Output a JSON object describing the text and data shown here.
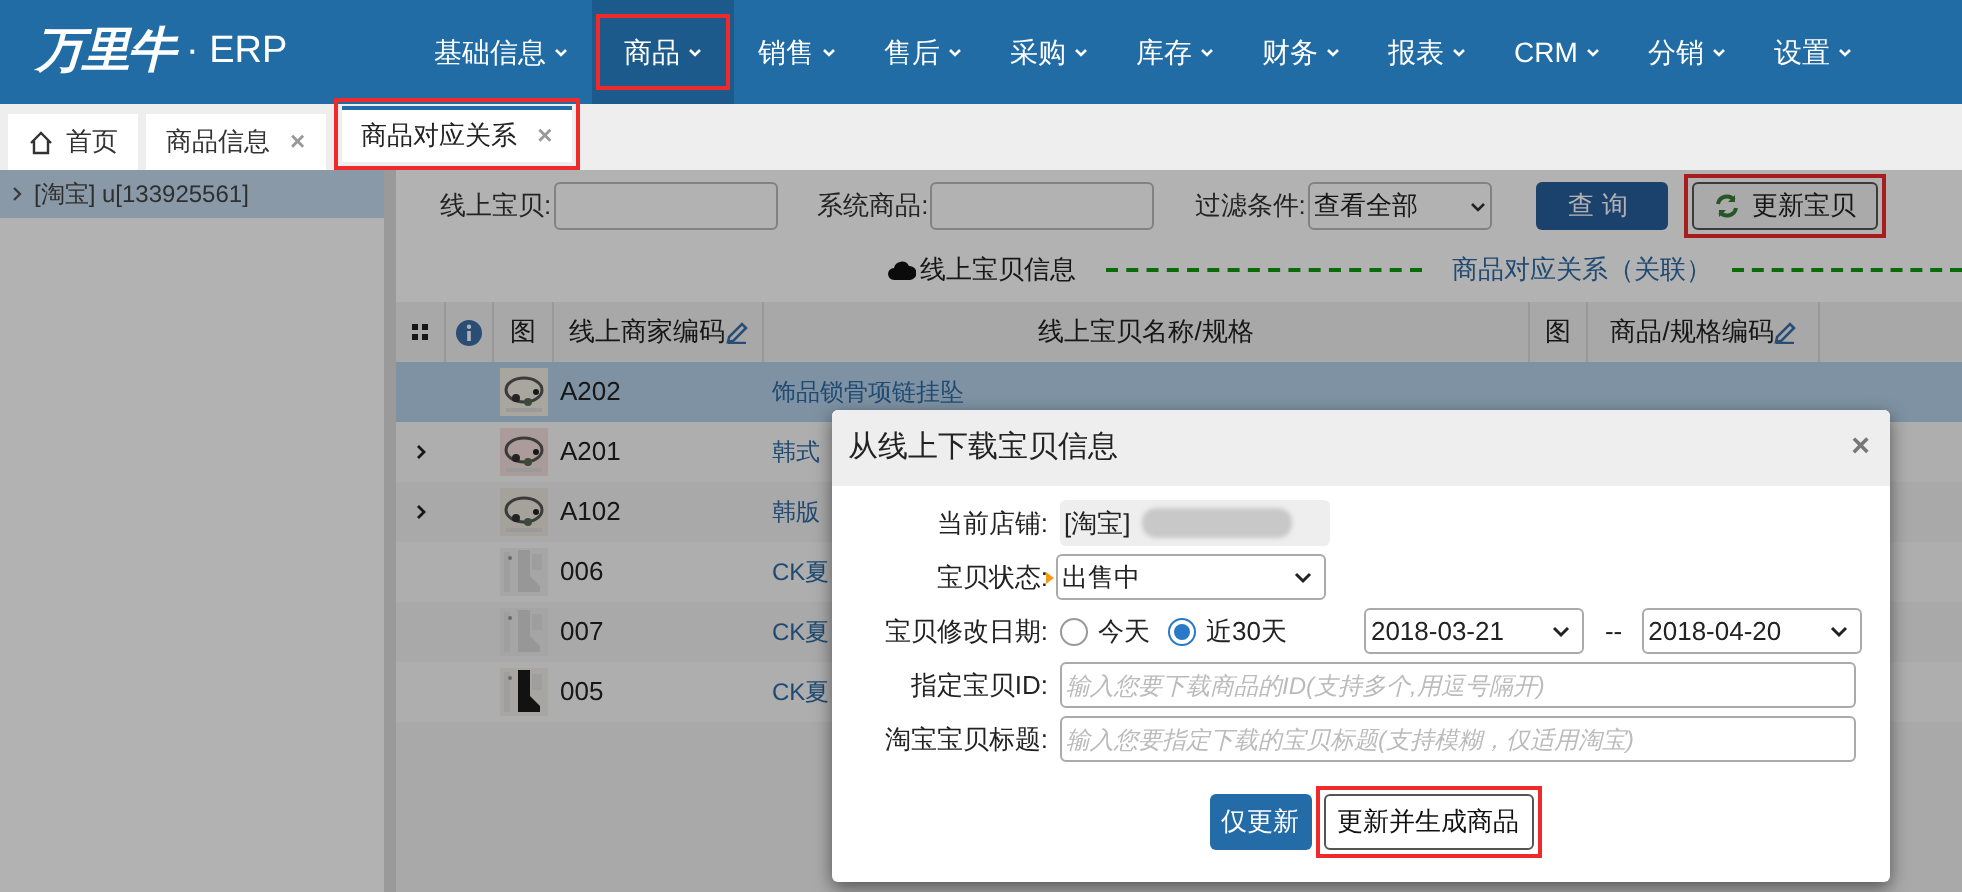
{
  "header": {
    "logo": "万里牛",
    "logo_suffix": "· ERP",
    "nav": [
      {
        "label": "基础信息",
        "selected": false,
        "highlighted": false
      },
      {
        "label": "商品",
        "selected": true,
        "highlighted": true
      },
      {
        "label": "销售",
        "selected": false,
        "highlighted": false
      },
      {
        "label": "售后",
        "selected": false,
        "highlighted": false
      },
      {
        "label": "采购",
        "selected": false,
        "highlighted": false
      },
      {
        "label": "库存",
        "selected": false,
        "highlighted": false
      },
      {
        "label": "财务",
        "selected": false,
        "highlighted": false
      },
      {
        "label": "报表",
        "selected": false,
        "highlighted": false
      },
      {
        "label": "CRM",
        "selected": false,
        "highlighted": false
      },
      {
        "label": "分销",
        "selected": false,
        "highlighted": false
      },
      {
        "label": "设置",
        "selected": false,
        "highlighted": false
      }
    ]
  },
  "tabs": [
    {
      "label": "首页",
      "kind": "home",
      "selected": false,
      "highlighted": false
    },
    {
      "label": "商品信息",
      "kind": "page",
      "close": "×",
      "selected": false,
      "highlighted": false
    },
    {
      "label": "商品对应关系",
      "kind": "page",
      "close": "×",
      "selected": true,
      "highlighted": true
    }
  ],
  "sidebar": {
    "items": [
      {
        "label": "[淘宝] u[133925561]",
        "selected": true
      }
    ]
  },
  "filters": [
    {
      "label": "线上宝贝:",
      "kind": "input"
    },
    {
      "label": "系统商品:",
      "kind": "input"
    },
    {
      "label": "过滤条件:",
      "kind": "select",
      "value": "查看全部"
    }
  ],
  "toolbar_buttons": [
    {
      "label": "查询",
      "kind": "primary",
      "highlighted": false
    },
    {
      "label": "更新宝贝",
      "kind": "refresh",
      "highlighted": true
    }
  ],
  "sections": {
    "left": "线上宝贝信息",
    "right": "商品对应关系（关联）"
  },
  "table": {
    "columns": [
      {
        "kind": "grid"
      },
      {
        "kind": "info"
      },
      {
        "kind": "text",
        "label": "图"
      },
      {
        "kind": "text",
        "label": "线上商家编码",
        "editable": true
      },
      {
        "kind": "text",
        "label": "线上宝贝名称/规格"
      },
      {
        "kind": "text",
        "label": "图"
      },
      {
        "kind": "text",
        "label": "商品/规格编码",
        "editable": true
      }
    ],
    "rows": [
      {
        "code": "A202",
        "name": "饰品锁骨项链挂坠",
        "selected": true,
        "expandable": false
      },
      {
        "code": "A201",
        "name": "韩式",
        "selected": false,
        "expandable": true
      },
      {
        "code": "A102",
        "name": "韩版",
        "selected": false,
        "expandable": true
      },
      {
        "code": "006",
        "name": "CK夏",
        "selected": false,
        "expandable": false
      },
      {
        "code": "007",
        "name": "CK夏",
        "selected": false,
        "expandable": false
      },
      {
        "code": "005",
        "name": "CK夏",
        "selected": false,
        "expandable": false
      }
    ]
  },
  "dialog": {
    "title": "从线上下载宝贝信息",
    "close": "×",
    "fields": [
      {
        "kind": "readonly",
        "label": "当前店铺:",
        "value": "[淘宝]",
        "redacted": true
      },
      {
        "kind": "select",
        "label": "宝贝状态:",
        "value": "出售中",
        "required": true
      },
      {
        "kind": "daterange",
        "label": "宝贝修改日期:",
        "options": [
          {
            "label": "今天",
            "selected": false
          },
          {
            "label": "近30天",
            "selected": true
          }
        ],
        "from": "2018-03-21",
        "separator": "--",
        "to": "2018-04-20"
      },
      {
        "kind": "input",
        "label": "指定宝贝ID:",
        "placeholder": "输入您要下载商品的ID(支持多个,用逗号隔开)"
      },
      {
        "kind": "input",
        "label": "淘宝宝贝标题:",
        "placeholder": "输入您要指定下载的宝贝标题(支持模糊，仅适用淘宝)"
      }
    ],
    "buttons": [
      {
        "label": "仅更新",
        "kind": "primary",
        "highlighted": false
      },
      {
        "label": "更新并生成商品",
        "kind": "default",
        "highlighted": true
      }
    ]
  }
}
